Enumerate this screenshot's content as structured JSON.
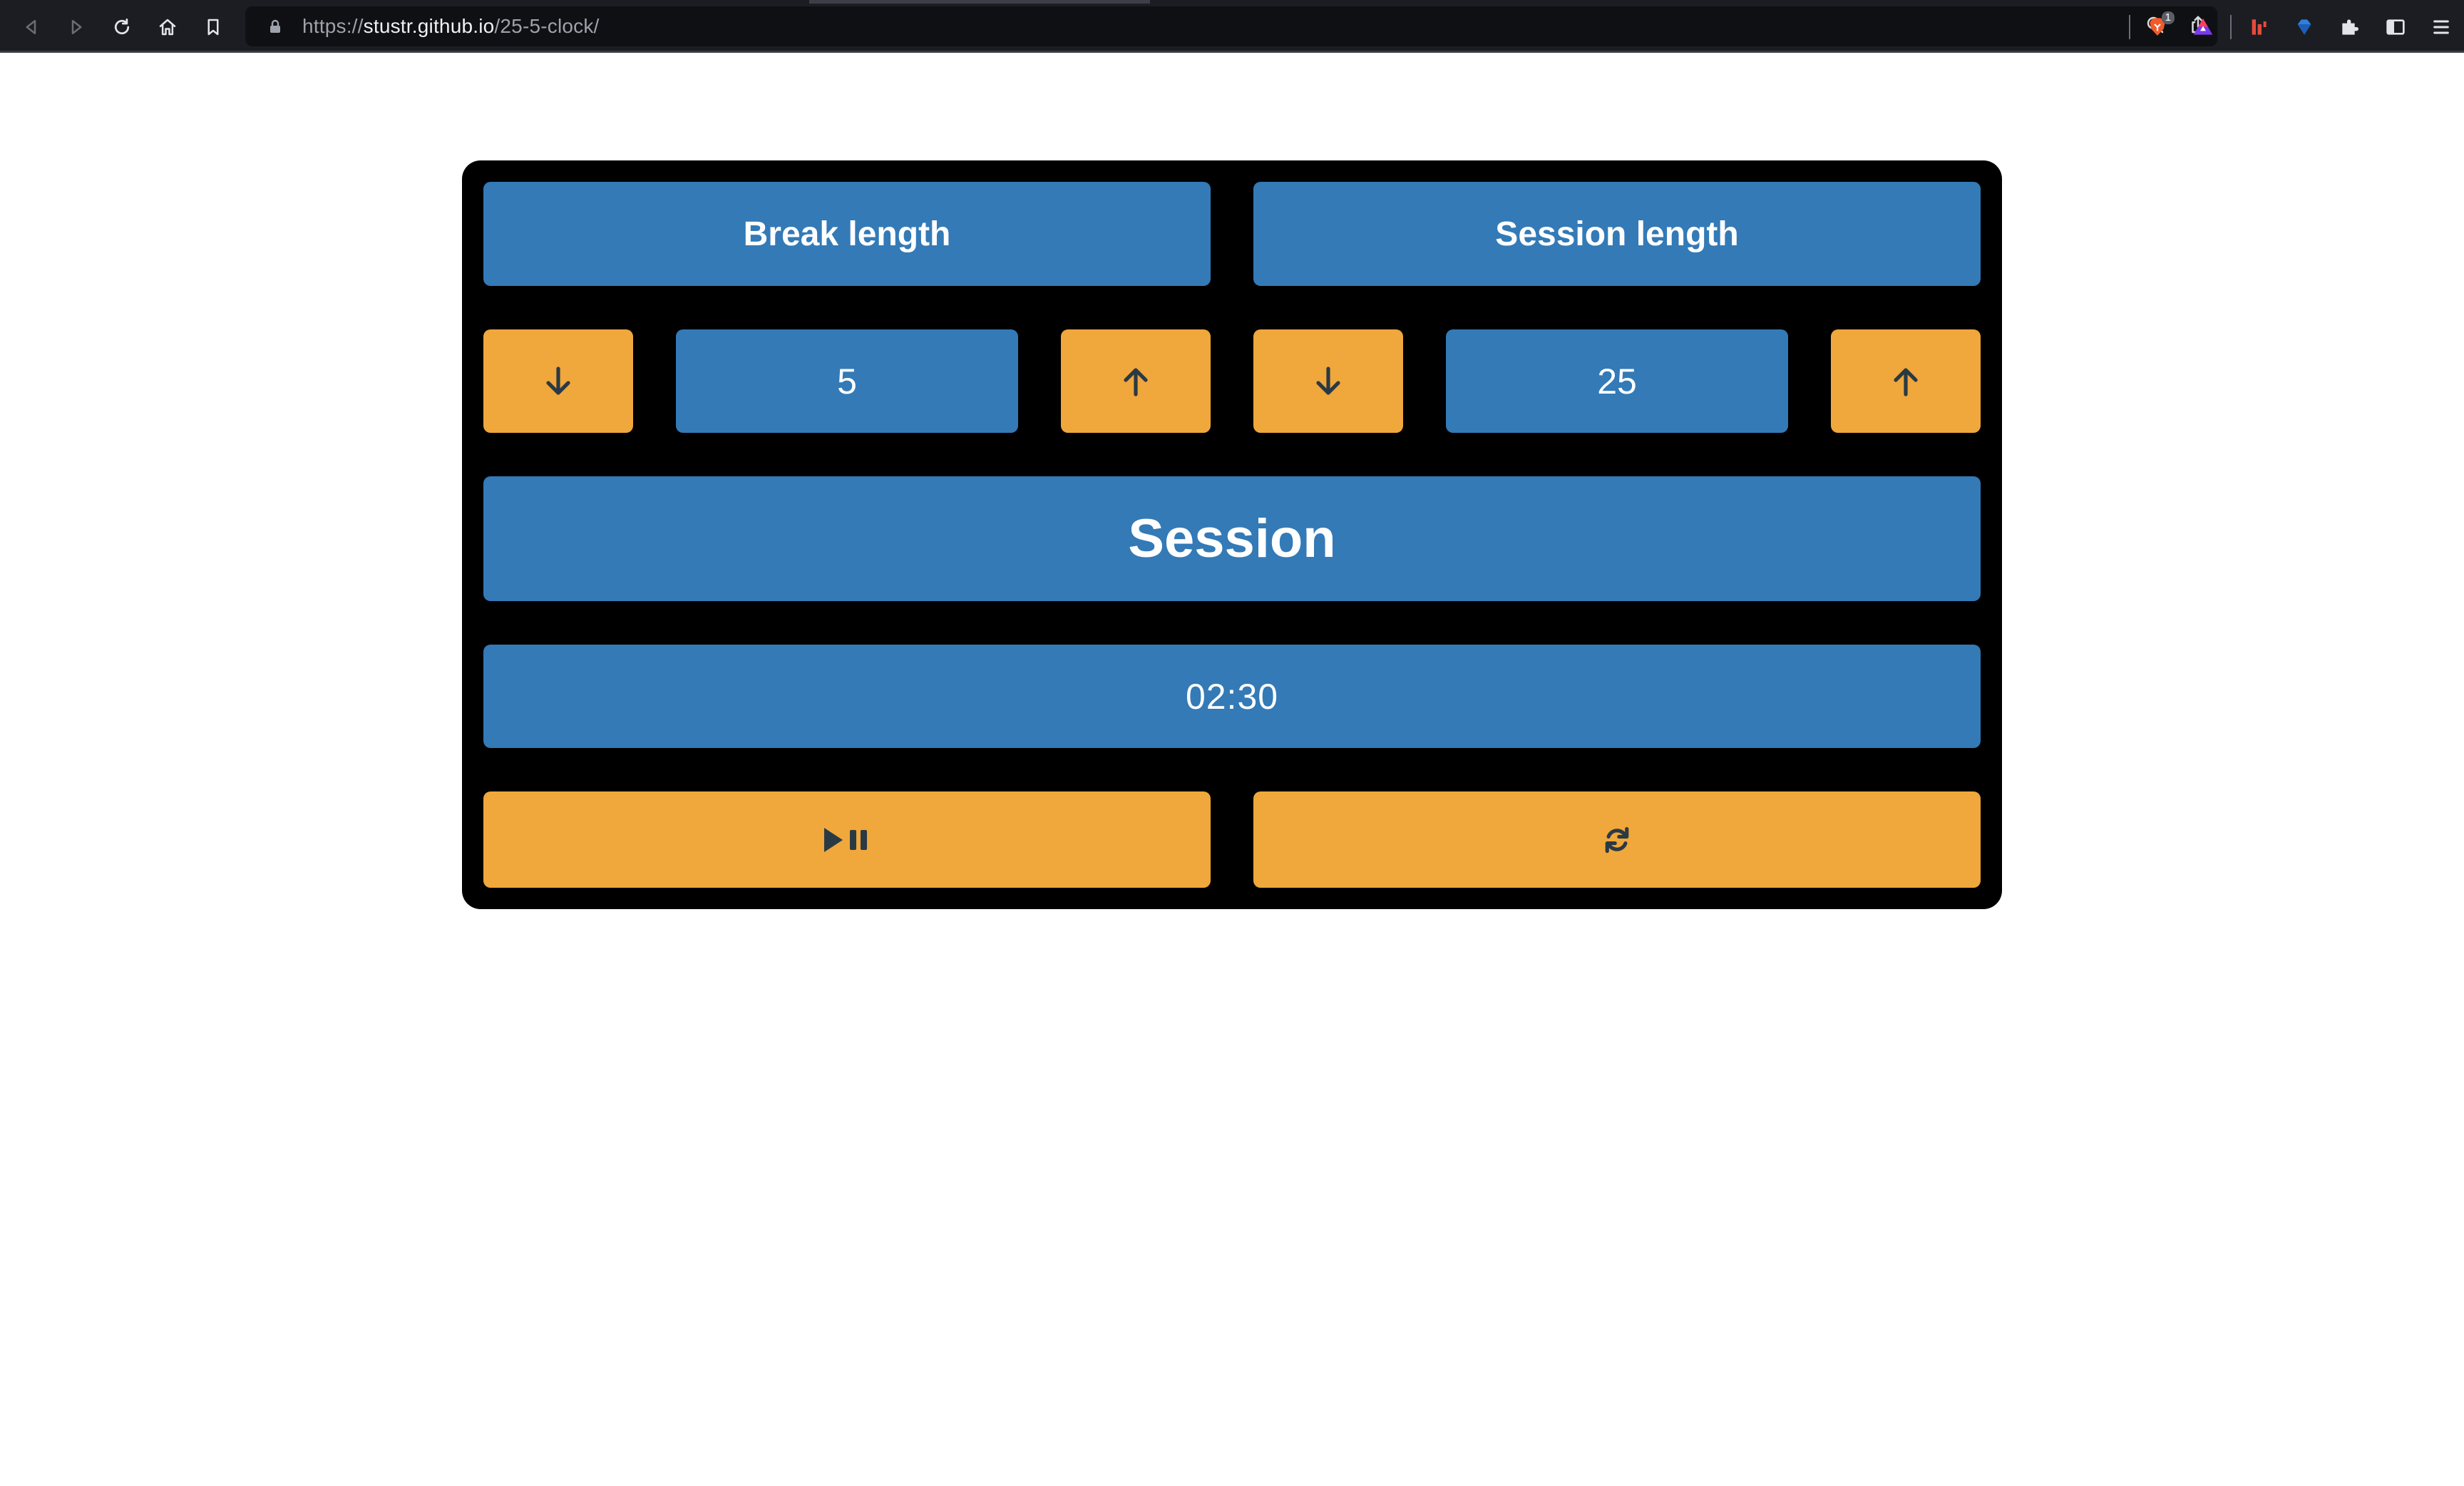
{
  "browser": {
    "url_scheme": "https://",
    "url_host": "stustr.github.io",
    "url_path": "/25-5-clock/",
    "extension_badge": "1"
  },
  "clock": {
    "break_label": "Break length",
    "session_label": "Session length",
    "break_length": "5",
    "session_length": "25",
    "timer_label": "Session",
    "time_left": "02:30",
    "icons": {
      "decrement": "arrow-down-icon",
      "increment": "arrow-up-icon",
      "start_stop": "play-pause-icon",
      "reset": "refresh-icon"
    }
  },
  "colors": {
    "panel": "#000000",
    "blue": "#337ab7",
    "orange": "#f0a73b",
    "icon_dark": "#2a3a45"
  }
}
